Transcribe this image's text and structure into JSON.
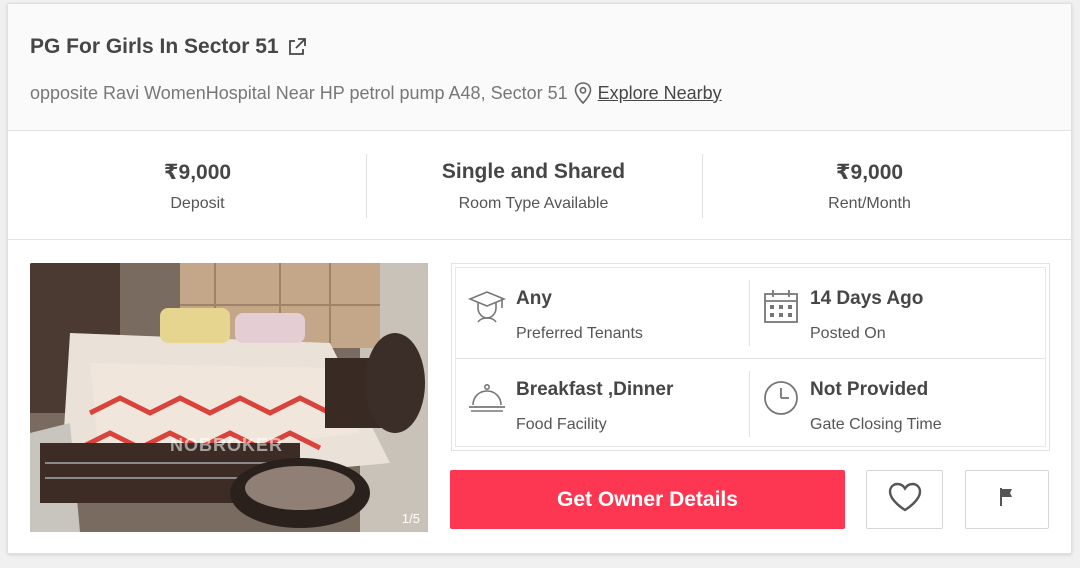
{
  "header": {
    "title": "PG For Girls In Sector 51",
    "address": "opposite Ravi WomenHospital Near HP petrol pump A48, Sector 51",
    "explore_label": "Explore Nearby"
  },
  "stats": [
    {
      "value": "₹9,000",
      "label": "Deposit"
    },
    {
      "value": "Single and Shared",
      "label": "Room Type Available"
    },
    {
      "value": "₹9,000",
      "label": "Rent/Month"
    }
  ],
  "photo": {
    "counter": "1/5",
    "watermark": "NOBROKER"
  },
  "details": [
    {
      "icon": "graduate-icon",
      "value": "Any",
      "label": "Preferred Tenants"
    },
    {
      "icon": "calendar-icon",
      "value": "14 Days Ago",
      "label": "Posted On"
    },
    {
      "icon": "food-cloche-icon",
      "value": "Breakfast ,Dinner",
      "label": "Food Facility"
    },
    {
      "icon": "clock-icon",
      "value": "Not Provided",
      "label": "Gate Closing Time"
    }
  ],
  "actions": {
    "cta_label": "Get Owner Details",
    "favorite_icon": "heart-icon",
    "report_icon": "flag-icon"
  },
  "colors": {
    "accent": "#fd3752",
    "text": "#464646",
    "muted": "#777777"
  }
}
